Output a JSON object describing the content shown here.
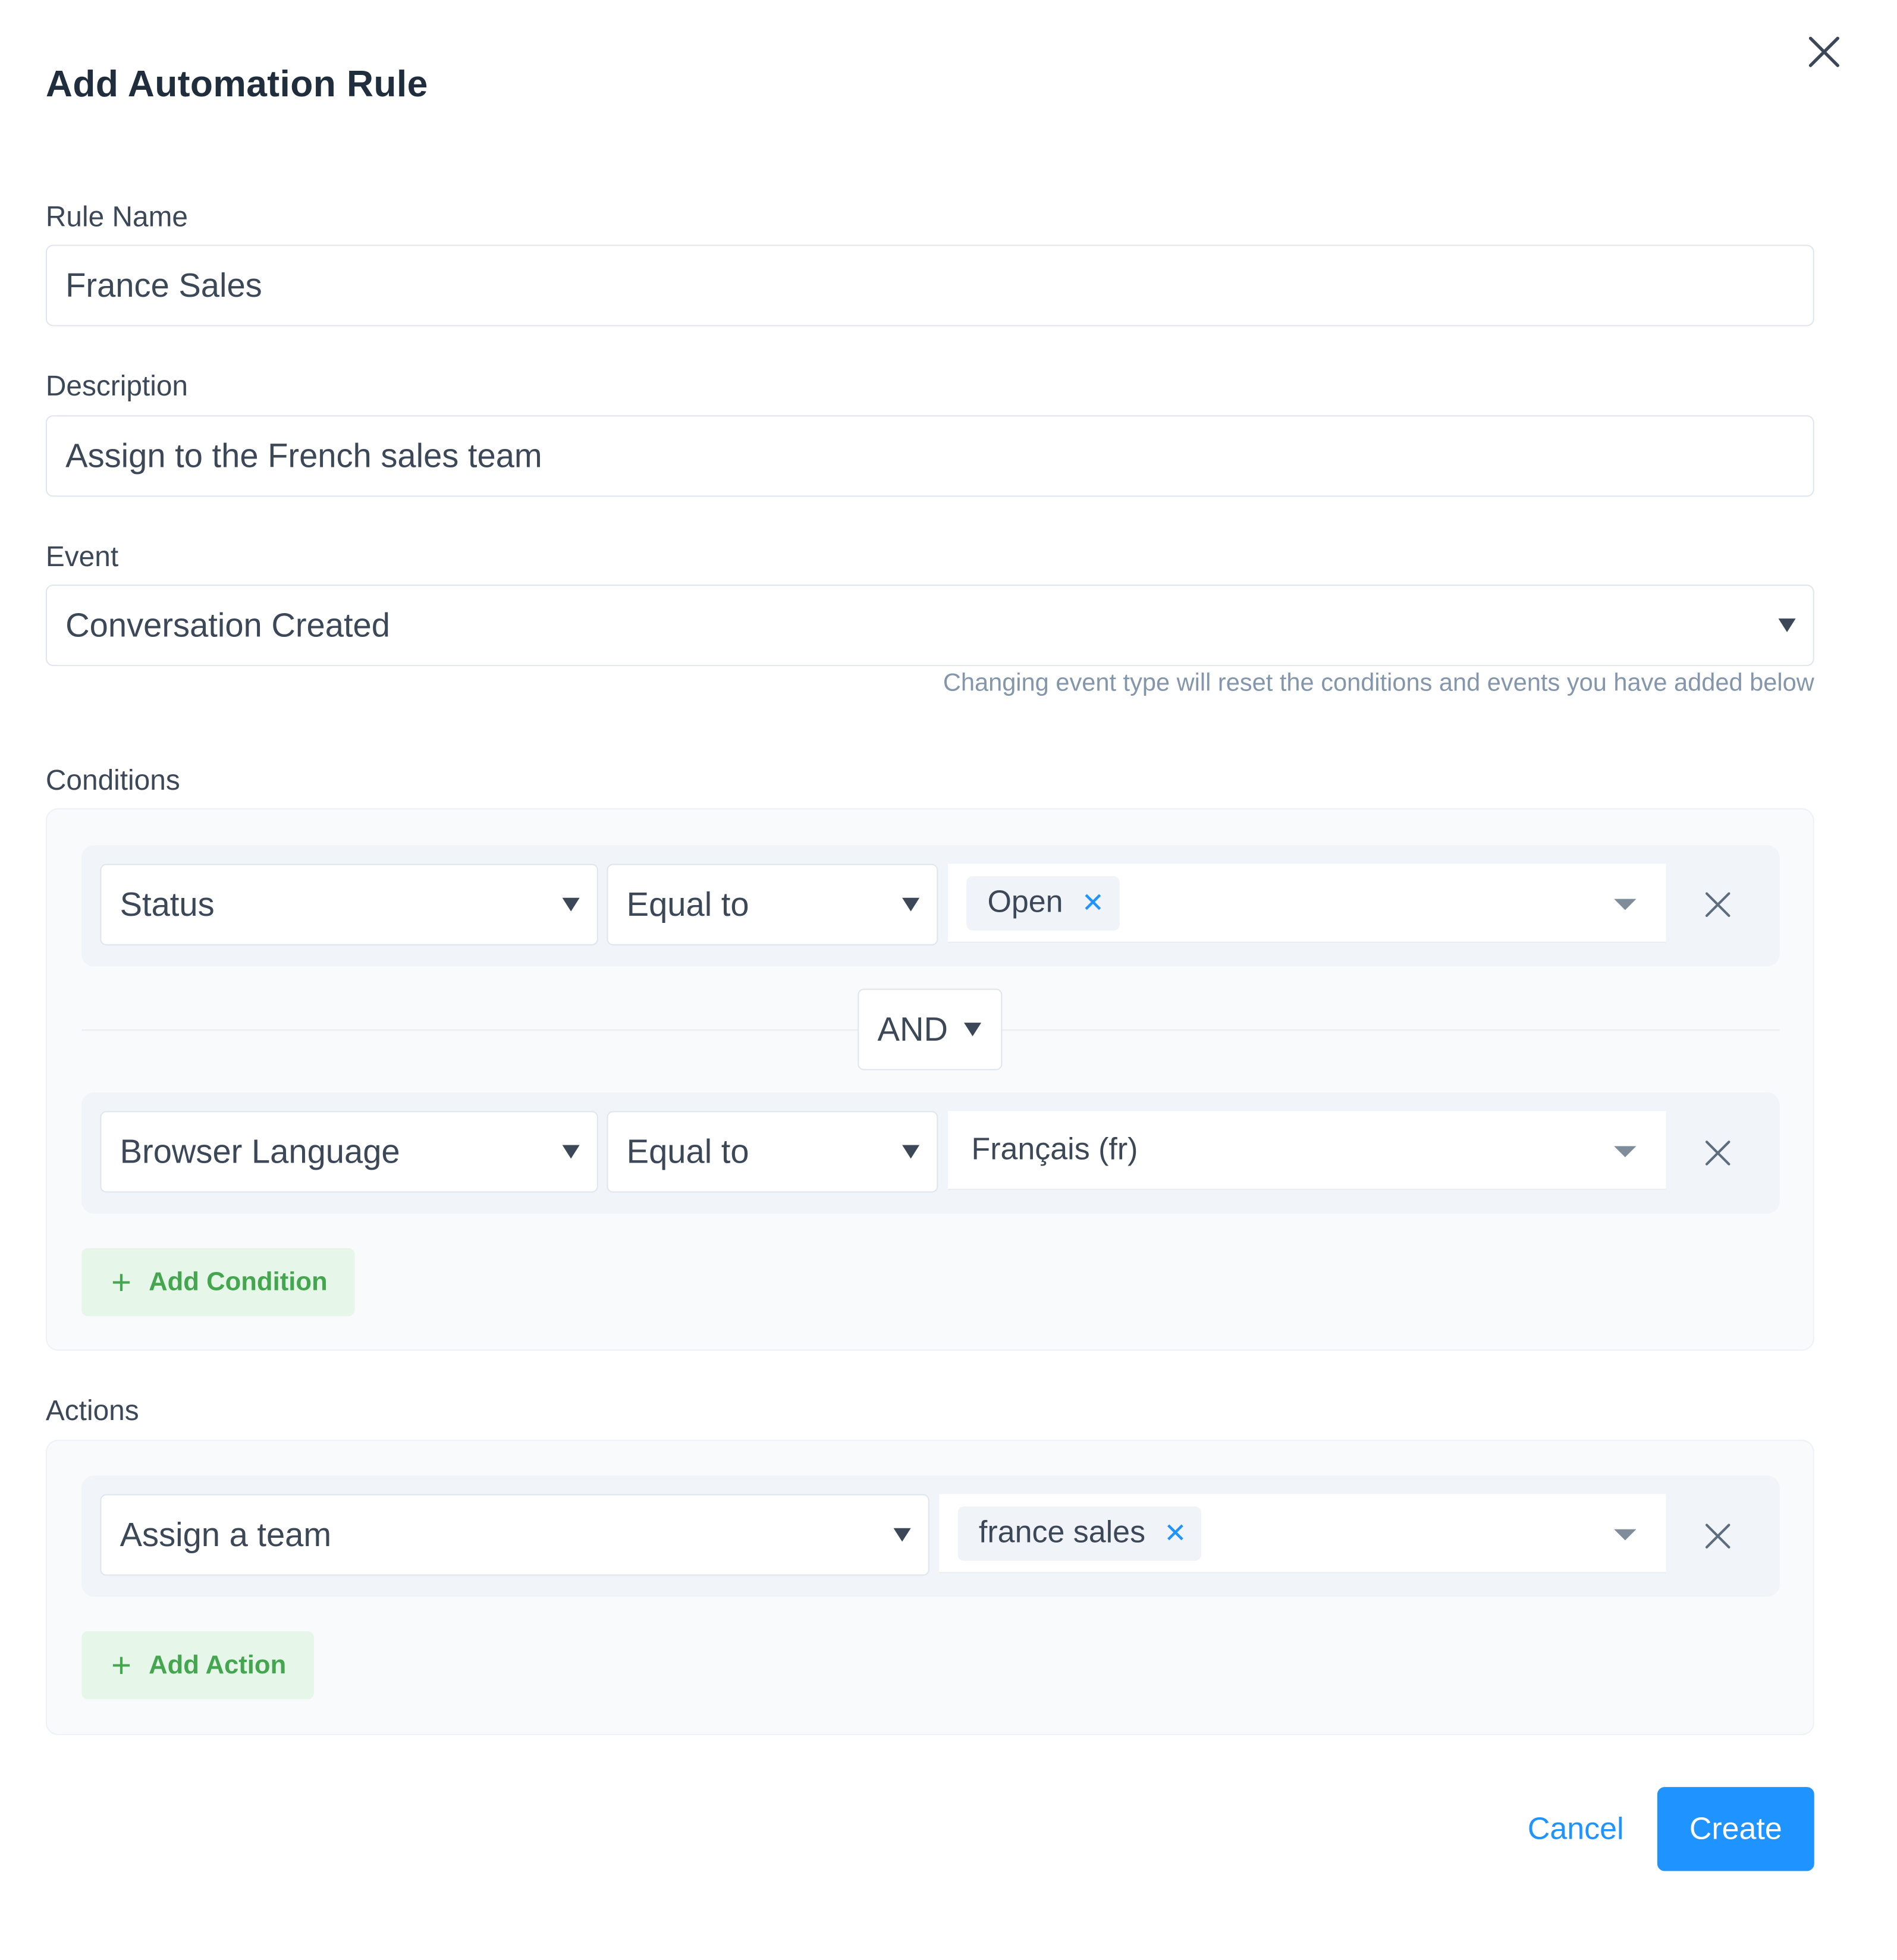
{
  "modal": {
    "title": "Add Automation Rule"
  },
  "rule_name": {
    "label": "Rule Name",
    "value": "France Sales"
  },
  "description": {
    "label": "Description",
    "value": "Assign to the French sales team"
  },
  "event": {
    "label": "Event",
    "value": "Conversation Created",
    "helper": "Changing event type will reset the conditions and events you have added below"
  },
  "conditions": {
    "label": "Conditions",
    "rows": [
      {
        "attribute": "Status",
        "operator": "Equal to",
        "tags": [
          "Open"
        ]
      },
      {
        "attribute": "Browser Language",
        "operator": "Equal to",
        "value": "Français (fr)"
      }
    ],
    "query_operator": "AND",
    "add_label": "Add Condition"
  },
  "actions": {
    "label": "Actions",
    "rows": [
      {
        "action": "Assign a team",
        "tags": [
          "france sales"
        ]
      }
    ],
    "add_label": "Add Action"
  },
  "footer": {
    "cancel_label": "Cancel",
    "create_label": "Create"
  },
  "colors": {
    "primary": "#1f93ff",
    "success": "#44a64e",
    "success_bg": "#e6f6e9",
    "text": "#3c4858",
    "helper_text": "#8396ab"
  },
  "icons": {
    "close": "close-icon",
    "remove": "remove-icon",
    "tag_remove": "tag-remove-icon",
    "dropdown": "caret-down-icon",
    "add": "plus-icon"
  }
}
